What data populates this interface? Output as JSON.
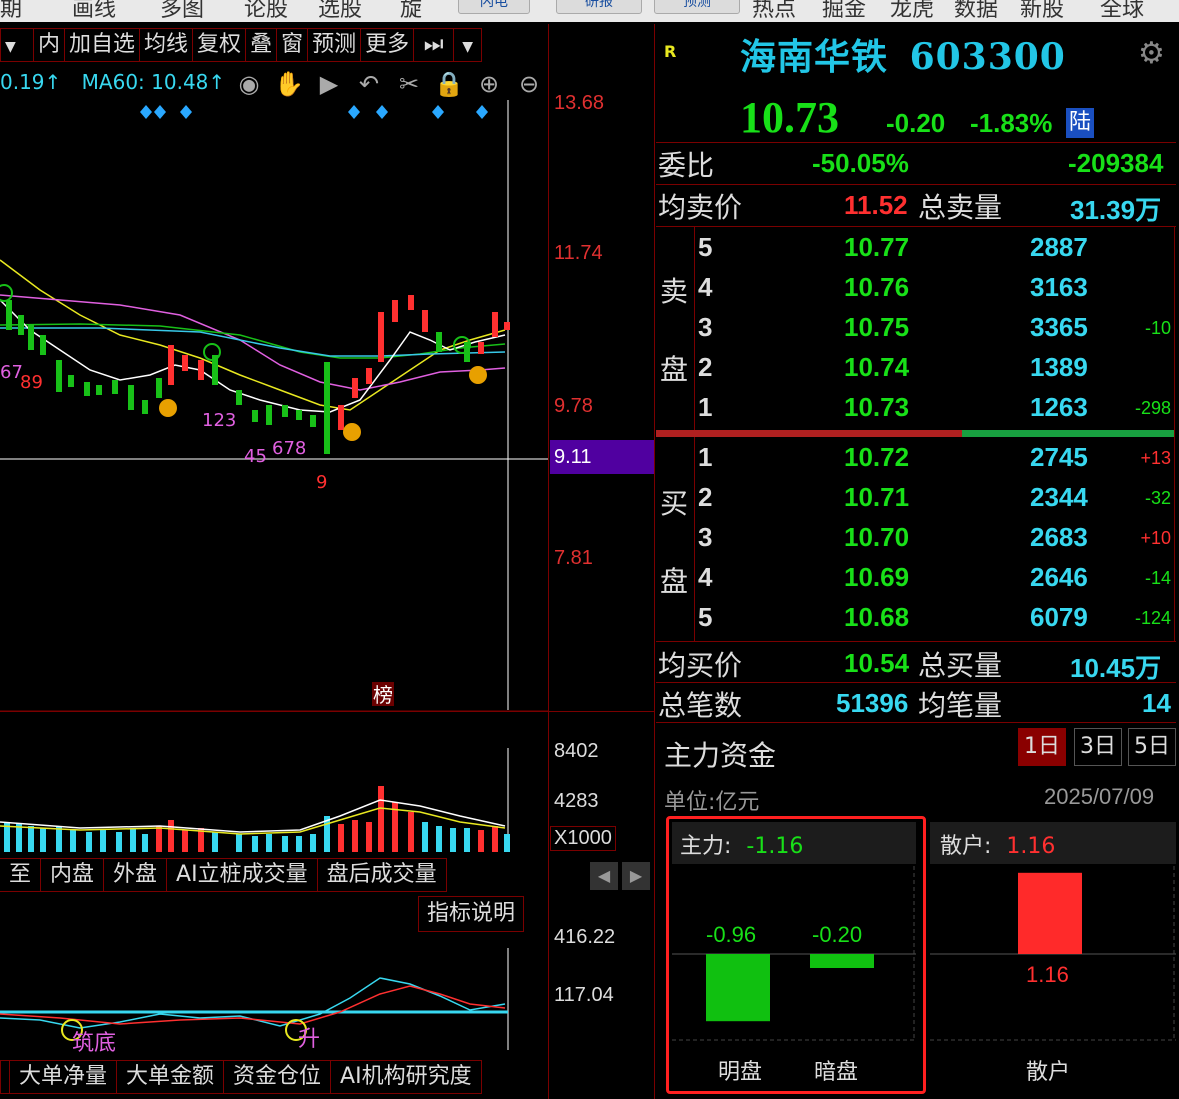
{
  "topnav": {
    "items": [
      "期",
      "画线",
      "多图",
      "论股",
      "选股",
      "旋",
      "热点",
      "掘金",
      "龙虎",
      "数据",
      "新股",
      "全球"
    ],
    "buttons": [
      "闪电",
      "研报",
      "预测"
    ]
  },
  "toolbar": {
    "items": [
      "内",
      "加自选",
      "均线",
      "复权",
      "叠",
      "窗",
      "预测",
      "更多"
    ]
  },
  "ma_legend": {
    "ma_prev": "0.19↑",
    "ma60": "MA60: 10.48↑"
  },
  "price_axis": [
    "13.68",
    "11.74",
    "9.78",
    "9.11",
    "7.81"
  ],
  "volume_axis": [
    "8402",
    "4283",
    "X1000"
  ],
  "indicator_axis": [
    "416.22",
    "117.04"
  ],
  "chart_annotations": {
    "seq1": "67",
    "seq2": "89",
    "seq3": "123",
    "seq4": "45",
    "seq5": "678",
    "seq6": "9",
    "bang": "榜",
    "zhudi": "筑底",
    "sheng": "升"
  },
  "volume_tabs": [
    "至",
    "内盘",
    "外盘",
    "AI立桩成交量",
    "盘后成交量"
  ],
  "indicator_help": "指标说明",
  "bottom_tabs": [
    "大单净量",
    "大单金额",
    "资金仓位",
    "AI机构研究度"
  ],
  "quote": {
    "r_badge": "R",
    "name": "海南华铁",
    "code": "603300",
    "price": "10.73",
    "change": "-0.20",
    "change_pct": "-1.83%",
    "lu": "陆",
    "weibi_label": "委比",
    "weibi": "-50.05%",
    "weicha": "-209384",
    "avg_sell_label": "均卖价",
    "avg_sell": "11.52",
    "total_sell_label": "总卖量",
    "total_sell": "31.39万",
    "sell_label_a": "卖",
    "sell_label_b": "盘",
    "buy_label_a": "买",
    "buy_label_b": "盘",
    "sells": [
      {
        "lvl": "5",
        "price": "10.77",
        "vol": "2887",
        "chg": ""
      },
      {
        "lvl": "4",
        "price": "10.76",
        "vol": "3163",
        "chg": ""
      },
      {
        "lvl": "3",
        "price": "10.75",
        "vol": "3365",
        "chg": "-10"
      },
      {
        "lvl": "2",
        "price": "10.74",
        "vol": "1389",
        "chg": ""
      },
      {
        "lvl": "1",
        "price": "10.73",
        "vol": "1263",
        "chg": "-298"
      }
    ],
    "buys": [
      {
        "lvl": "1",
        "price": "10.72",
        "vol": "2745",
        "chg": "+13"
      },
      {
        "lvl": "2",
        "price": "10.71",
        "vol": "2344",
        "chg": "-32"
      },
      {
        "lvl": "3",
        "price": "10.70",
        "vol": "2683",
        "chg": "+10"
      },
      {
        "lvl": "4",
        "price": "10.69",
        "vol": "2646",
        "chg": "-14"
      },
      {
        "lvl": "5",
        "price": "10.68",
        "vol": "6079",
        "chg": "-124"
      }
    ],
    "avg_buy_label": "均买价",
    "avg_buy": "10.54",
    "total_buy_label": "总买量",
    "total_buy": "10.45万",
    "total_trades_label": "总笔数",
    "total_trades": "51396",
    "avg_trade_label": "均笔量",
    "avg_trade": "14"
  },
  "capital": {
    "title": "主力资金",
    "periods": [
      "1日",
      "3日",
      "5日"
    ],
    "unit": "单位:亿元",
    "date": "2025/07/09",
    "main_label": "主力:",
    "main_value": "-1.16",
    "retail_label": "散户:",
    "retail_value": "1.16",
    "mingpan_value": "-0.96",
    "anpan_value": "-0.20",
    "retail_bar_value": "1.16",
    "mingpan_label": "明盘",
    "anpan_label": "暗盘",
    "retail_bottom_label": "散户",
    "bars": {
      "mingpan": -0.96,
      "anpan": -0.2,
      "retail": 1.16
    }
  },
  "colors": {
    "up": "#ff3030",
    "down": "#18e018",
    "cyan": "#38d8f0",
    "frame": "#7a0000"
  }
}
